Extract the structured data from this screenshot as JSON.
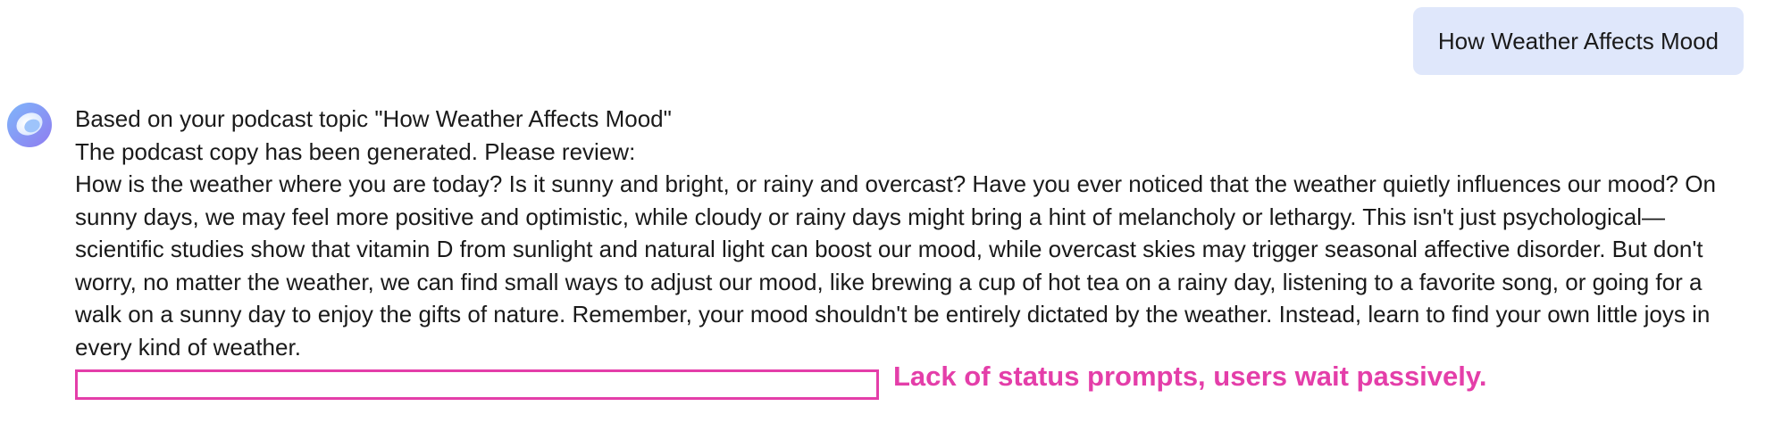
{
  "user_message": {
    "text": "How Weather Affects Mood"
  },
  "assistant": {
    "avatar_icon": "gradient-swirl-logo-icon",
    "intro_line": "Based on your podcast topic \"How Weather Affects Mood\"",
    "status_line": "The podcast copy has been generated. Please review:",
    "body": "How is the weather where you are today? Is it sunny and bright, or rainy and overcast? Have you ever noticed that the weather quietly influences our mood? On sunny days, we may feel more positive and optimistic, while cloudy or rainy days might bring a hint of melancholy or lethargy. This isn't just psychological—scientific studies show that vitamin D from sunlight and natural light can boost our mood, while overcast skies may trigger seasonal affective disorder. But don't worry, no matter the weather, we can find small ways to adjust our mood, like brewing a cup of hot tea on a rainy day, listening to a favorite song, or going for a walk on a sunny day to enjoy the gifts of nature. Remember, your mood shouldn't be entirely dictated by the weather. Instead, learn to find your own little joys in every kind of weather."
  },
  "annotation": {
    "text": "Lack of status prompts, users wait passively.",
    "color": "#e43ea9"
  },
  "colors": {
    "user_bubble_bg": "#dfe7fb",
    "avatar_gradient_start": "#6fa8f5",
    "avatar_gradient_end": "#9b7cf0"
  }
}
